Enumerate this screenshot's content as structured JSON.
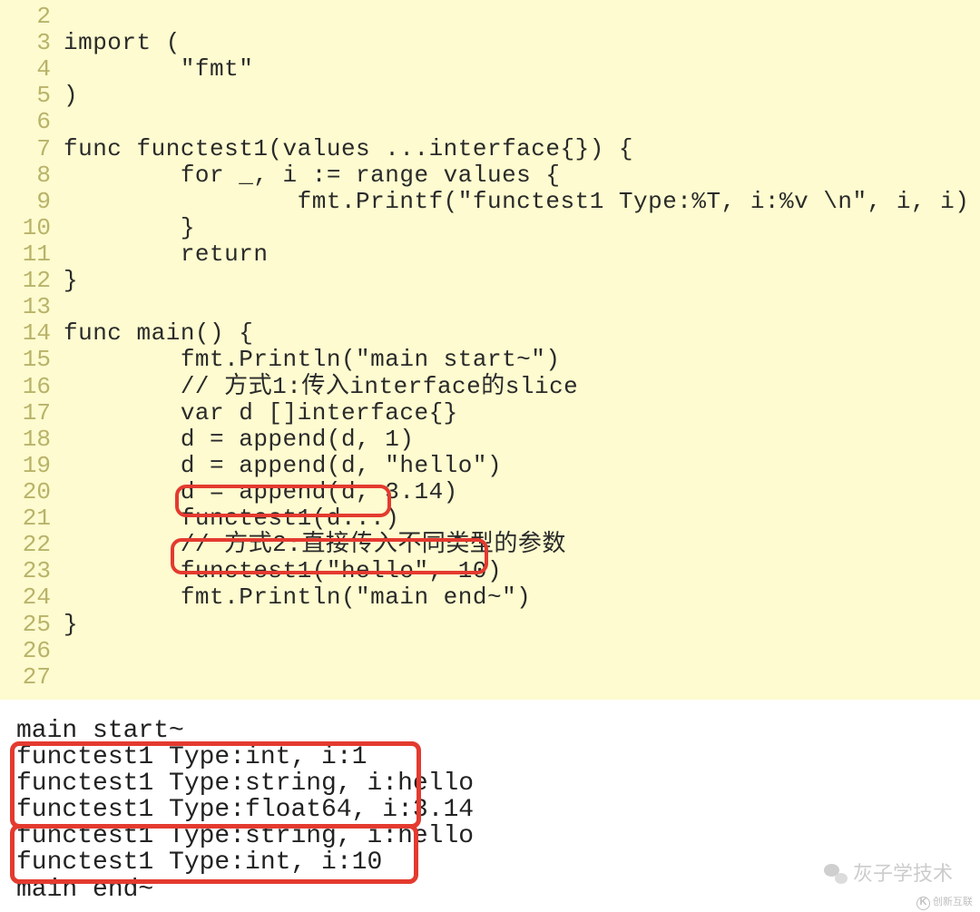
{
  "code": {
    "lines": [
      {
        "n": "2",
        "t": ""
      },
      {
        "n": "3",
        "t": "import ("
      },
      {
        "n": "4",
        "t": "        \"fmt\""
      },
      {
        "n": "5",
        "t": ")"
      },
      {
        "n": "6",
        "t": ""
      },
      {
        "n": "7",
        "t": "func functest1(values ...interface{}) {"
      },
      {
        "n": "8",
        "t": "        for _, i := range values {"
      },
      {
        "n": "9",
        "t": "                fmt.Printf(\"functest1 Type:%T, i:%v \\n\", i, i)"
      },
      {
        "n": "10",
        "t": "        }"
      },
      {
        "n": "11",
        "t": "        return"
      },
      {
        "n": "12",
        "t": "}"
      },
      {
        "n": "13",
        "t": ""
      },
      {
        "n": "14",
        "t": "func main() {"
      },
      {
        "n": "15",
        "t": "        fmt.Println(\"main start~\")"
      },
      {
        "n": "16",
        "t": "        // 方式1:传入interface的slice"
      },
      {
        "n": "17",
        "t": "        var d []interface{}"
      },
      {
        "n": "18",
        "t": "        d = append(d, 1)"
      },
      {
        "n": "19",
        "t": "        d = append(d, \"hello\")"
      },
      {
        "n": "20",
        "t": "        d = append(d, 3.14)"
      },
      {
        "n": "21",
        "t": "        functest1(d...)"
      },
      {
        "n": "22",
        "t": "        // 方式2:直接传入不同类型的参数"
      },
      {
        "n": "23",
        "t": "        functest1(\"hello\", 10)"
      },
      {
        "n": "24",
        "t": "        fmt.Println(\"main end~\")"
      },
      {
        "n": "25",
        "t": "}"
      },
      {
        "n": "26",
        "t": ""
      },
      {
        "n": "27",
        "t": ""
      }
    ]
  },
  "output": {
    "lines": [
      "main start~",
      "functest1 Type:int, i:1",
      "functest1 Type:string, i:hello",
      "functest1 Type:float64, i:3.14",
      "functest1 Type:string, i:hello",
      "functest1 Type:int, i:10",
      "main end~"
    ]
  },
  "watermark": "灰子学技术",
  "logo": "创新互联"
}
